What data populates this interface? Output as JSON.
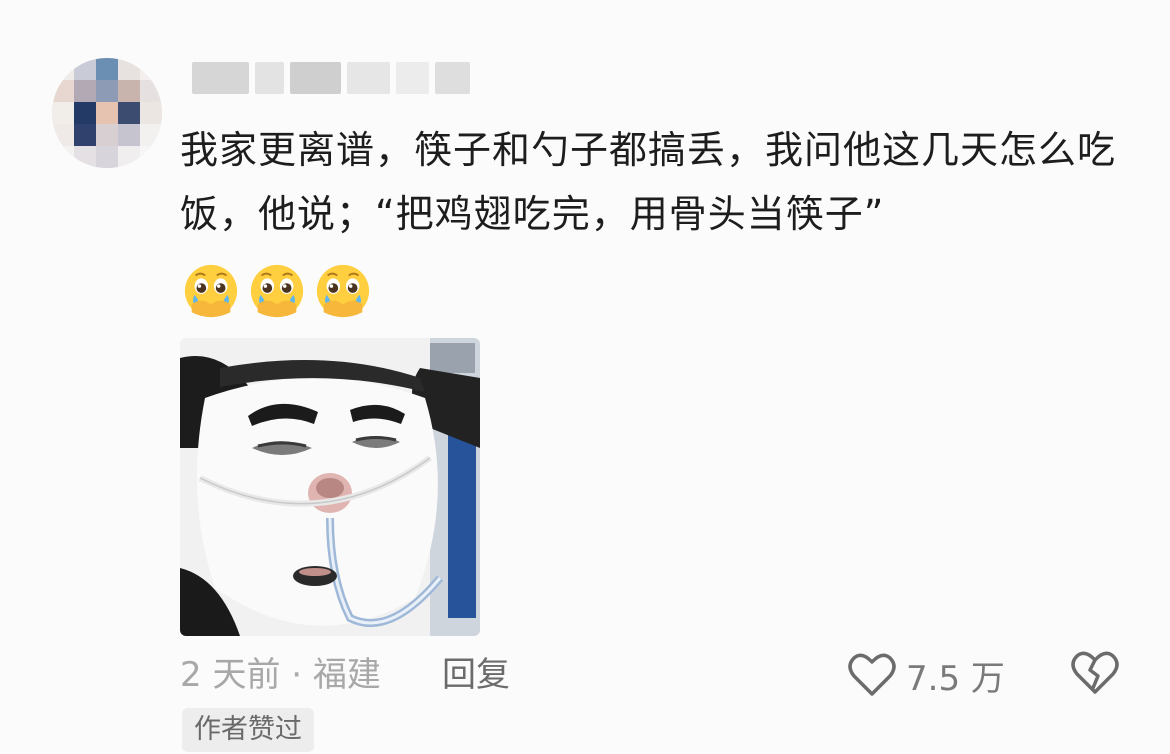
{
  "comment": {
    "text": "我家更离谱，筷子和勺子都搞丢，我问他这几天怎么吃饭，他说；“把鸡翅吃完，用骨头当筷子”",
    "emojis": [
      "crying-face-emoji",
      "crying-face-emoji",
      "crying-face-emoji"
    ],
    "sticker_icon": "panda-meme-sticker"
  },
  "meta": {
    "time_location": "2 天前 · 福建",
    "reply_label": "回复",
    "like_count": "7.5 万",
    "author_badge": "作者赞过"
  },
  "icons": {
    "like": "heart-outline-icon",
    "dislike": "broken-heart-icon"
  },
  "colors": {
    "background": "#fbfbfb",
    "text": "#1d1d1d",
    "muted": "#a8a8a8",
    "icon": "#6b6b6b"
  }
}
